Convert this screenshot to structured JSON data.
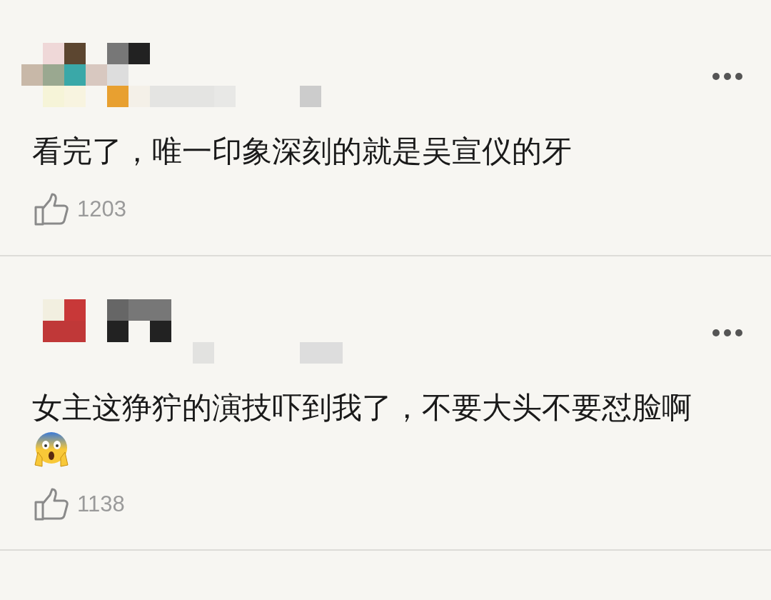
{
  "comments": [
    {
      "text": "看完了，唯一印象深刻的就是吴宣仪的牙",
      "has_emoji": false,
      "likes": "1203"
    },
    {
      "text": "女主这狰狞的演技吓到我了，不要大头不要怼脸啊",
      "has_emoji": true,
      "likes": "1138"
    }
  ]
}
